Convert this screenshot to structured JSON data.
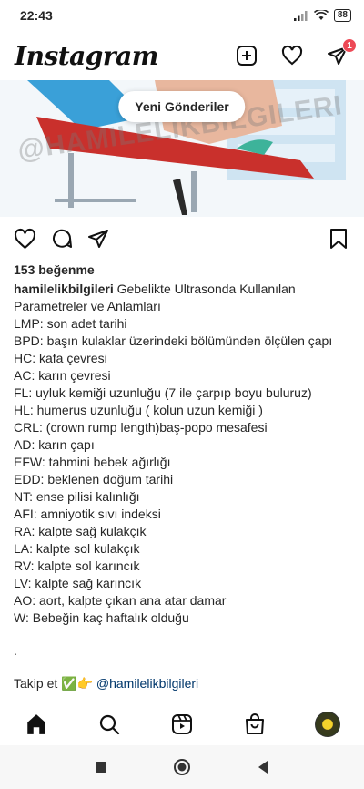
{
  "status_bar": {
    "time": "22:43",
    "battery": "88"
  },
  "header": {
    "logo": "Instagram",
    "messages_badge": "1"
  },
  "post": {
    "new_posts_pill": "Yeni Gönderiler",
    "watermark": "@HAMILELIKBILGILERI",
    "likes": "153 beğenme",
    "username": "hamilelikbilgileri",
    "caption_first": " Gebelikte Ultrasonda Kullanılan",
    "caption_lines": [
      "Parametreler ve Anlamları",
      "LMP: son adet tarihi",
      "BPD: başın kulaklar üzerindeki bölümünden ölçülen çapı",
      "HC: kafa çevresi",
      "AC: karın çevresi",
      "FL: uyluk kemiği uzunluğu (7 ile çarpıp boyu buluruz)",
      "HL: humerus uzunluğu ( kolun uzun kemiği )",
      "CRL: (crown rump length)baş-popo mesafesi",
      "AD: karın çapı",
      "EFW: tahmini bebek ağırlığı",
      "EDD: beklenen doğum tarihi",
      "NT: ense pilisi kalınlığı",
      "AFI: amniyotik sıvı indeksi",
      "RA: kalpte sağ kulakçık",
      "LA: kalpte sol kulakçık",
      "RV: kalpte sol karıncık",
      "LV: kalpte sağ karıncık",
      "AO: aort, kalpte çıkan ana atar damar",
      "W: Bebeğin kaç haftalık olduğu"
    ],
    "dot": ".",
    "follow_prefix": "Takip et ✅👉 ",
    "follow_mention": "@hamilelikbilgileri"
  },
  "icons": {
    "status": [
      "signal-icon",
      "wifi-icon",
      "battery-icon"
    ],
    "header": [
      "new-post-icon",
      "heart-icon",
      "direct-icon"
    ],
    "post_actions": [
      "like-icon",
      "comment-icon",
      "share-icon",
      "bookmark-icon"
    ],
    "bottom_nav": [
      "home-icon",
      "search-icon",
      "reels-icon",
      "shop-icon",
      "profile-avatar"
    ],
    "system_nav": [
      "recents-icon",
      "home-button-icon",
      "back-icon"
    ]
  },
  "colors": {
    "badge": "#ed4956",
    "mention": "#00376b",
    "text": "#262626"
  }
}
